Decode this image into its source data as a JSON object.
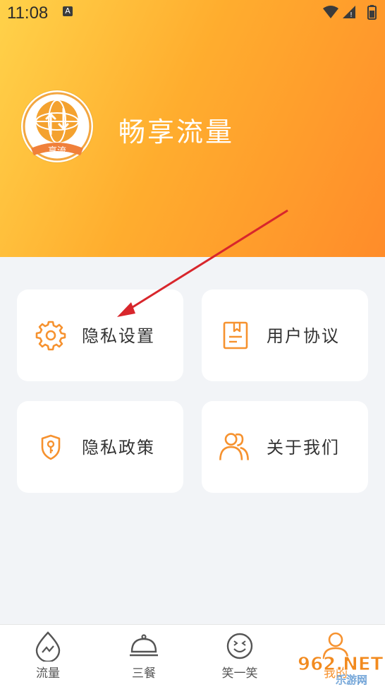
{
  "status_bar": {
    "time": "11:08",
    "notif_letter": "A"
  },
  "header": {
    "app_name": "畅享流量",
    "logo_caption": "享流"
  },
  "menu": {
    "privacy_settings": "隐私设置",
    "user_agreement": "用户协议",
    "privacy_policy": "隐私政策",
    "about_us": "关于我们"
  },
  "tabs": [
    {
      "label": "流量",
      "icon": "water-drop-icon"
    },
    {
      "label": "三餐",
      "icon": "cloche-icon"
    },
    {
      "label": "笑一笑",
      "icon": "smile-icon"
    },
    {
      "label": "我的",
      "icon": "person-icon"
    }
  ],
  "watermark": {
    "text": "962.NET",
    "sub": "乐游网"
  },
  "colors": {
    "accent": "#f6922f",
    "header_start": "#ffd24a",
    "header_end": "#ff8c2a",
    "arrow": "#d8262c"
  }
}
